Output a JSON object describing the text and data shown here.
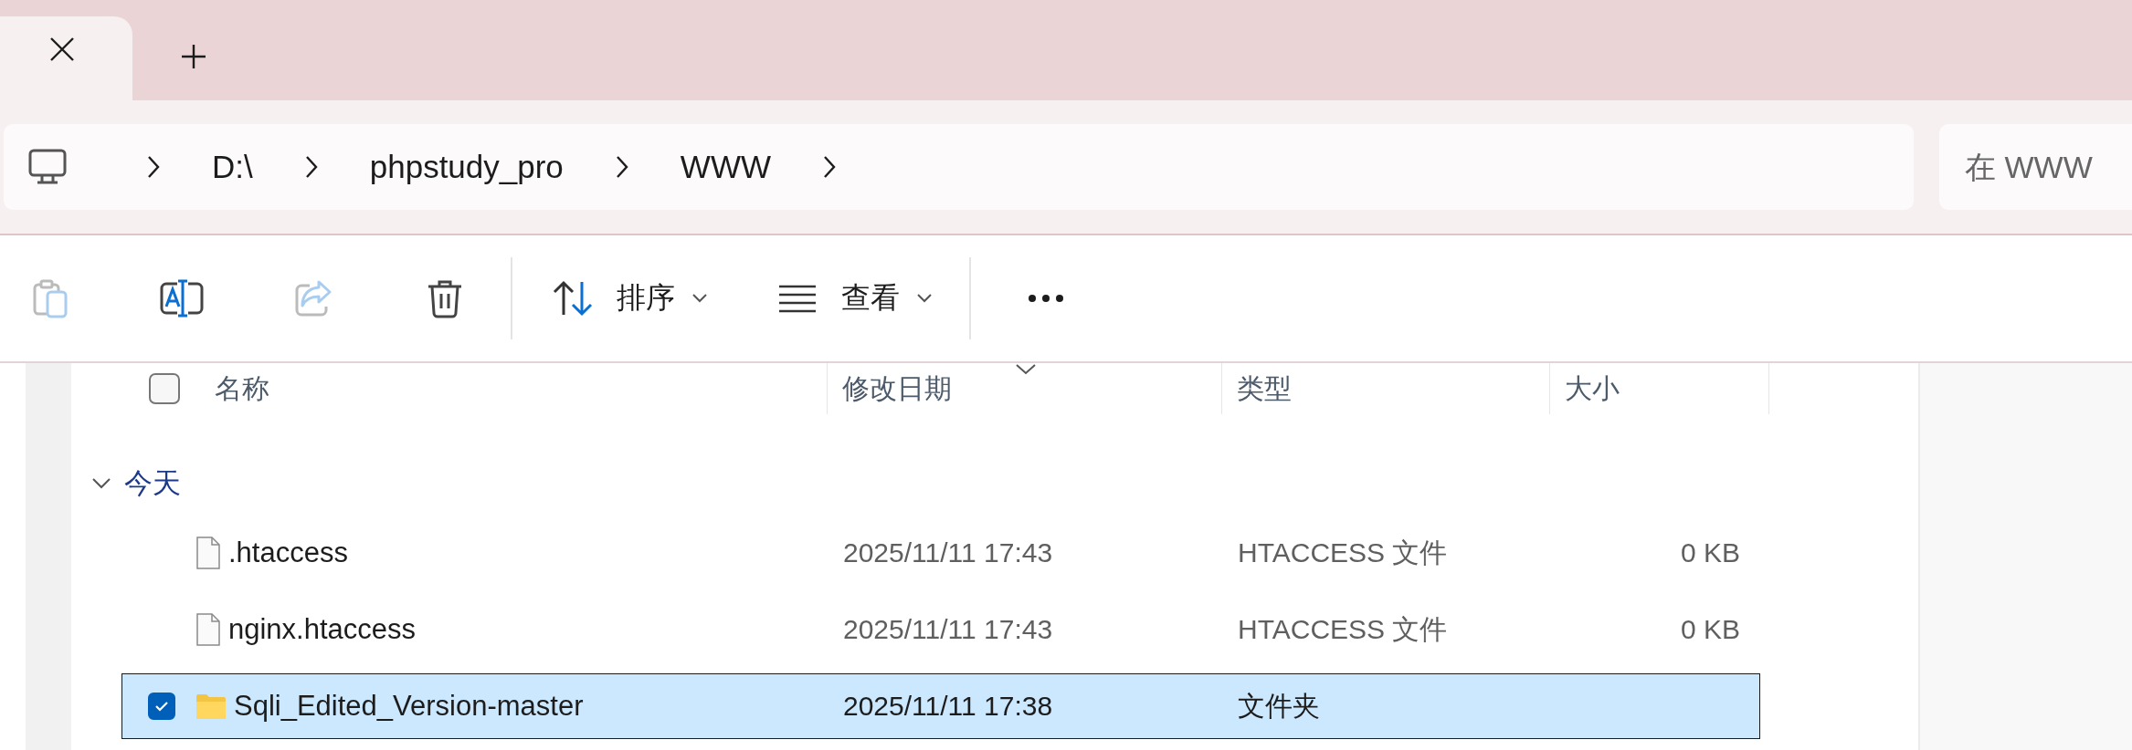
{
  "breadcrumb": [
    "D:\\",
    "phpstudy_pro",
    "WWW"
  ],
  "search": {
    "placeholder": "在 WWW"
  },
  "toolbar": {
    "actions": [
      {
        "kind": "paste",
        "disabled": true
      },
      {
        "kind": "rename",
        "disabled": false
      },
      {
        "kind": "share",
        "disabled": true
      },
      {
        "kind": "delete",
        "disabled": false
      }
    ],
    "menus": [
      {
        "kind": "sort",
        "label": "排序"
      },
      {
        "kind": "view",
        "label": "查看"
      }
    ]
  },
  "table": {
    "select_all": {
      "checked": false
    },
    "columns": [
      {
        "label": "名称",
        "sorted": false
      },
      {
        "label": "修改日期",
        "sorted": true
      },
      {
        "label": "类型",
        "sorted": false
      },
      {
        "label": "大小",
        "sorted": false
      }
    ],
    "groups": [
      {
        "label": "今天",
        "expanded": true,
        "rows": [
          {
            "kind": "file",
            "name": ".htaccess",
            "modified": "2025/11/11 17:43",
            "type": "HTACCESS 文件",
            "size": "0 KB",
            "selected": false
          },
          {
            "kind": "file",
            "name": "nginx.htaccess",
            "modified": "2025/11/11 17:43",
            "type": "HTACCESS 文件",
            "size": "0 KB",
            "selected": false
          },
          {
            "kind": "folder",
            "name": "Sqli_Edited_Version-master",
            "modified": "2025/11/11 17:38",
            "type": "文件夹",
            "selected": true
          }
        ]
      }
    ]
  }
}
